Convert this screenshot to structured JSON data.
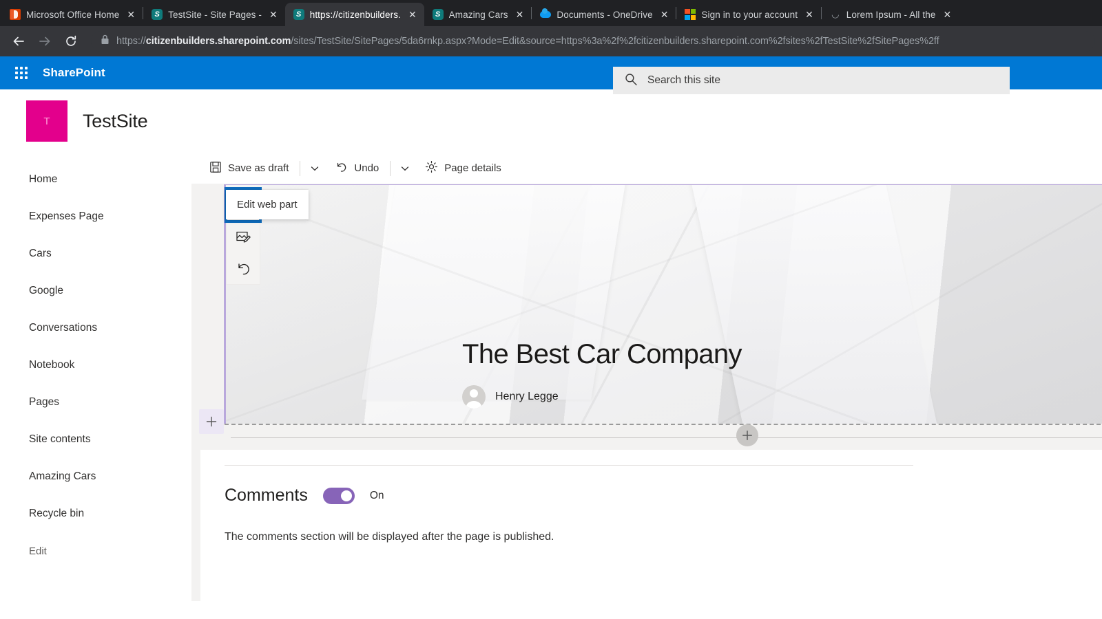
{
  "browser": {
    "tabs": [
      {
        "title": "Microsoft Office Home",
        "favicon": "office-icon",
        "active": false,
        "close_label": "✕"
      },
      {
        "title": "TestSite - Site Pages -",
        "favicon": "sharepoint-icon",
        "active": false,
        "close_label": "✕"
      },
      {
        "title": "https://citizenbuilders.",
        "favicon": "sharepoint-icon",
        "active": true,
        "close_label": "✕"
      },
      {
        "title": "Amazing Cars",
        "favicon": "sharepoint-icon",
        "active": false,
        "close_label": "✕"
      },
      {
        "title": "Documents - OneDrive",
        "favicon": "onedrive-icon",
        "active": false,
        "close_label": "✕"
      },
      {
        "title": "Sign in to your account",
        "favicon": "microsoft-icon",
        "active": false,
        "close_label": "✕"
      },
      {
        "title": "Lorem Ipsum - All the",
        "favicon": "generic-page-icon",
        "active": false,
        "close_label": "✕"
      }
    ],
    "nav": {
      "back": "back-arrow",
      "forward": "forward-arrow",
      "reload": "reload-icon"
    },
    "url": {
      "scheme": "https://",
      "host": "citizenbuilders.sharepoint.com",
      "path": "/sites/TestSite/SitePages/5da6rnkp.aspx?Mode=Edit&source=https%3a%2f%2fcitizenbuilders.sharepoint.com%2fsites%2fTestSite%2fSitePages%2ff",
      "lock": "lock-icon"
    }
  },
  "suitebar": {
    "waffle": "app-launcher-icon",
    "brand": "SharePoint",
    "accent_color": "#0078d4"
  },
  "search": {
    "icon": "search-icon",
    "placeholder": "Search this site"
  },
  "site": {
    "logo_letter": "T",
    "logo_color": "#e3008c",
    "title": "TestSite"
  },
  "sidebar": {
    "items": [
      {
        "label": "Home",
        "muted": false
      },
      {
        "label": "Expenses Page",
        "muted": false
      },
      {
        "label": "Cars",
        "muted": false
      },
      {
        "label": "Google",
        "muted": false
      },
      {
        "label": "Conversations",
        "muted": false
      },
      {
        "label": "Notebook",
        "muted": false
      },
      {
        "label": "Pages",
        "muted": false
      },
      {
        "label": "Site contents",
        "muted": false
      },
      {
        "label": "Amazing Cars",
        "muted": false
      },
      {
        "label": "Recycle bin",
        "muted": false
      },
      {
        "label": "Edit",
        "muted": true
      }
    ]
  },
  "commandbar": {
    "save_label": "Save as draft",
    "save_icon": "save-icon",
    "save_chevron": "chevron-down-icon",
    "undo_label": "Undo",
    "undo_icon": "undo-icon",
    "undo_chevron": "chevron-down-icon",
    "page_details_label": "Page details",
    "page_details_icon": "gear-icon"
  },
  "webpart_toolbar": {
    "buttons": [
      {
        "name": "edit-web-part",
        "icon": "pencil-icon",
        "selected": true
      },
      {
        "name": "change-image",
        "icon": "image-edit-icon",
        "selected": false
      },
      {
        "name": "revert",
        "icon": "undo-icon",
        "selected": false
      }
    ],
    "tooltip": "Edit web part",
    "selection_color": "#0f6cbd"
  },
  "hero": {
    "title": "The Best Car Company",
    "author": "Henry Legge",
    "avatar": "person-avatar-icon",
    "section_accent": "#b9a8dc"
  },
  "canvas": {
    "add_section_icon": "plus-icon",
    "add_webpart_icon": "plus-icon"
  },
  "comments": {
    "title": "Comments",
    "toggle_state": "On",
    "toggle_on": true,
    "toggle_color": "#8764b8",
    "note": "The comments section will be displayed after the page is published."
  }
}
